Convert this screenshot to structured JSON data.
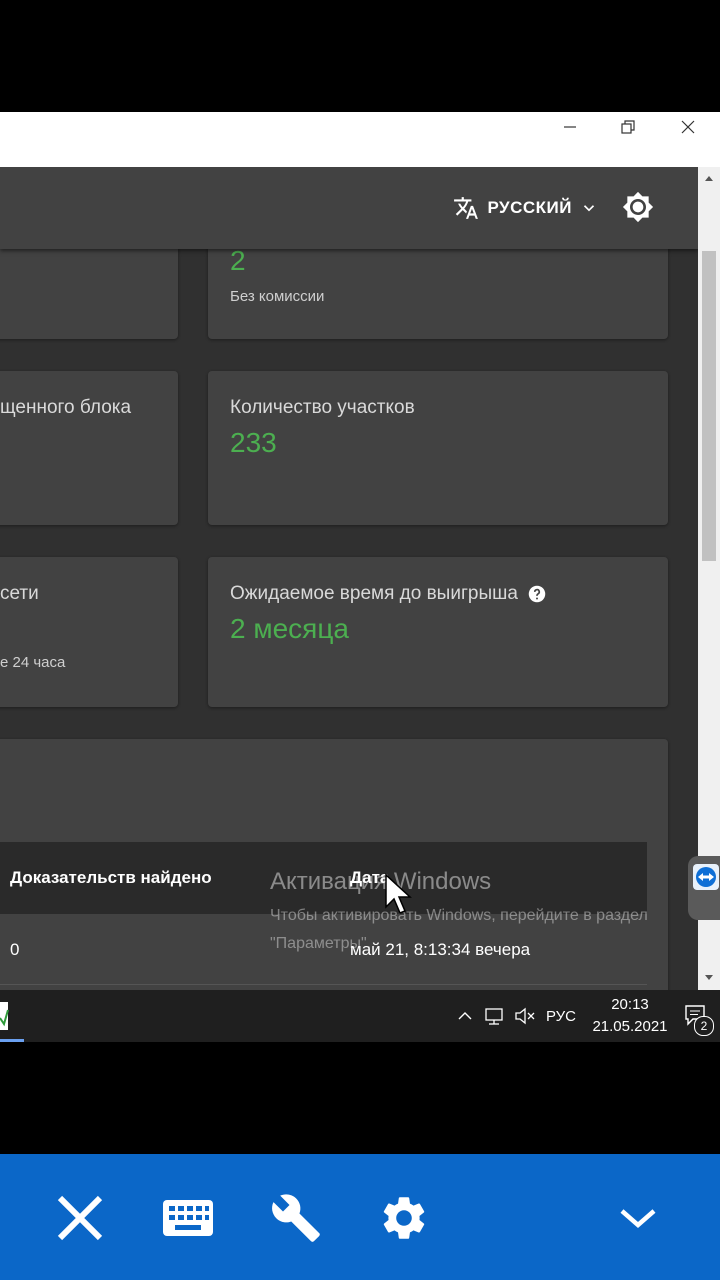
{
  "appbar": {
    "language": "РУССКИЙ"
  },
  "cards": {
    "top_right": {
      "value": "2",
      "sub": "Без комиссии"
    },
    "mid_left": {
      "label": "щенного блока"
    },
    "mid_right": {
      "label": "Количество участков",
      "value": "233"
    },
    "low_left": {
      "label": "сети",
      "sub": "е 24 часа"
    },
    "low_right": {
      "label": "Ожидаемое время до выигрыша",
      "value": "2 месяца"
    }
  },
  "table": {
    "headers": [
      "Доказательств найдено",
      "Дата"
    ],
    "rows": [
      {
        "proofs": "0",
        "date": "май 21, 8:13:34 вечера"
      }
    ]
  },
  "watermark": {
    "title": "Активация Windows",
    "text": "Чтобы активировать Windows, перейдите в раздел \"Параметры\"."
  },
  "taskbar": {
    "lang": "РУС",
    "time": "20:13",
    "date": "21.05.2021",
    "notifications": "2"
  },
  "colors": {
    "accent_green": "#4caf50",
    "toolbar_blue": "#0b67c8"
  }
}
